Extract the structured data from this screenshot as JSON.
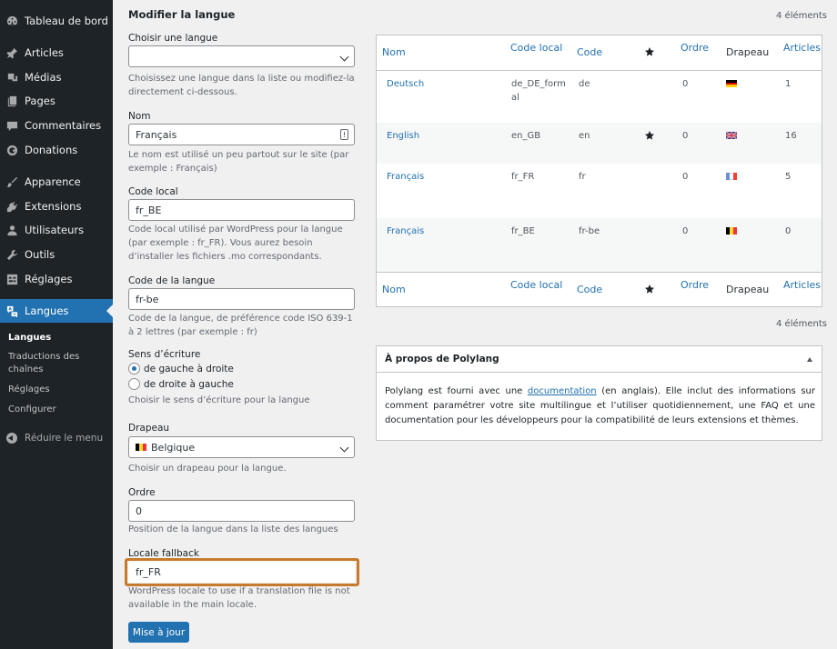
{
  "sidebar": {
    "items": [
      {
        "label": "Tableau de bord",
        "icon": "dashboard-icon"
      },
      {
        "label": "Articles",
        "icon": "pin-icon"
      },
      {
        "label": "Médias",
        "icon": "media-icon"
      },
      {
        "label": "Pages",
        "icon": "pages-icon"
      },
      {
        "label": "Commentaires",
        "icon": "comments-icon"
      },
      {
        "label": "Donations",
        "icon": "donations-icon"
      },
      {
        "label": "Apparence",
        "icon": "brush-icon"
      },
      {
        "label": "Extensions",
        "icon": "plugins-icon"
      },
      {
        "label": "Utilisateurs",
        "icon": "users-icon"
      },
      {
        "label": "Outils",
        "icon": "wrench-icon"
      },
      {
        "label": "Réglages",
        "icon": "settings-icon"
      },
      {
        "label": "Langues",
        "icon": "translation-icon"
      }
    ],
    "submenu": [
      "Langues",
      "Traductions des chaînes",
      "Réglages",
      "Configurer"
    ],
    "collapse_label": "Réduire le menu"
  },
  "form": {
    "title": "Modifier la langue",
    "choose_label": "Choisir une langue",
    "choose_value": "",
    "choose_desc": "Choisissez une langue dans la liste ou modifiez-la directement ci-dessous.",
    "name_label": "Nom",
    "name_value": "Français",
    "name_desc": "Le nom est utilisé un peu partout sur le site (par exemple : Français)",
    "locale_label": "Code local",
    "locale_value": "fr_BE",
    "locale_desc": "Code local utilisé par WordPress pour la langue (par exemple : fr_FR). Vous aurez besoin d’installer les fichiers .mo correspondants.",
    "slug_label": "Code de la langue",
    "slug_value": "fr-be",
    "slug_desc": "Code de la langue, de préférence code ISO 639-1 à 2 lettres (par exemple : fr)",
    "direction_label": "Sens d’écriture",
    "ltr_label": "de gauche à droite",
    "rtl_label": "de droite à gauche",
    "direction_desc": "Choisir le sens d’écriture pour la langue",
    "flag_label": "Drapeau",
    "flag_value": "Belgique",
    "flag_desc": "Choisir un drapeau pour la langue.",
    "order_label": "Ordre",
    "order_value": "0",
    "order_desc": "Position de la langue dans la liste des langues",
    "fallback_label": "Locale fallback",
    "fallback_value": "fr_FR",
    "fallback_desc": "WordPress locale to use if a translation file is not available in the main locale.",
    "submit_label": "Mise à jour"
  },
  "table": {
    "count_top": "4 éléments",
    "count_bottom": "4 éléments",
    "headers": {
      "name": "Nom",
      "locale": "Code local",
      "code": "Code",
      "order": "Ordre",
      "flag": "Drapeau",
      "articles": "Articles"
    },
    "rows": [
      {
        "name": "Deutsch",
        "locale": "de_DE_formal",
        "code": "de",
        "default": false,
        "order": "0",
        "flag": "de",
        "articles": "1"
      },
      {
        "name": "English",
        "locale": "en_GB",
        "code": "en",
        "default": true,
        "order": "0",
        "flag": "gb",
        "articles": "16"
      },
      {
        "name": "Français",
        "locale": "fr_FR",
        "code": "fr",
        "default": false,
        "order": "0",
        "flag": "fr",
        "articles": "5"
      },
      {
        "name": "Français",
        "locale": "fr_BE",
        "code": "fr-be",
        "default": false,
        "order": "0",
        "flag": "be",
        "articles": "0"
      }
    ]
  },
  "about": {
    "title": "À propos de Polylang",
    "text_before": "Polylang est fourni avec une ",
    "link": "documentation",
    "text_after": " (en anglais). Elle inclut des informations sur comment paramétrer votre site multilingue et l’utiliser quotidiennement, une FAQ et une documentation pour les développeurs pour la compatibilité de leurs extensions et thèmes."
  },
  "colors": {
    "accent": "#2271b1",
    "sidebar_bg": "#1d2327",
    "highlight": "#c77a2b"
  }
}
